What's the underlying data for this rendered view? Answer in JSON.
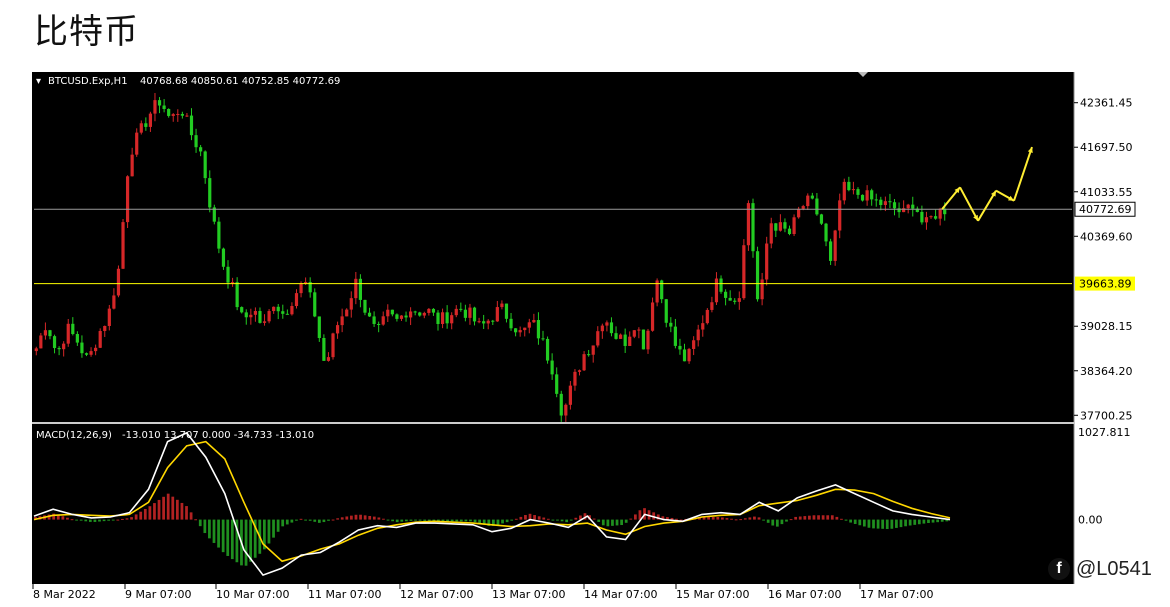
{
  "page": {
    "title": "比特币"
  },
  "watermark": {
    "text": "@L0541",
    "icon": "facebook-icon"
  },
  "colors": {
    "bull": "#d62728",
    "bear": "#22cc22",
    "macd_line": "#ffffff",
    "signal_line": "#ffd700",
    "level_price": "#ffff00",
    "current_line": "#9a9a9a",
    "arrow": "#ffee33"
  },
  "chart_data": [
    {
      "type": "candlestick",
      "title": "BTCUSD.Exp,H1",
      "ohlc_header": "40768.68 40850.61 40752.85 40772.69",
      "y_ticks": [
        "42361.45",
        "41697.50",
        "41033.55",
        "40369.60",
        "39028.15",
        "38364.20",
        "37700.25"
      ],
      "y_tick_values": [
        42361.45,
        41697.5,
        41033.55,
        40369.6,
        39028.15,
        38364.2,
        37700.25
      ],
      "ylim": [
        37600,
        42700
      ],
      "x_ticks": [
        "8 Mar 2022",
        "9 Mar 07:00",
        "10 Mar 07:00",
        "11 Mar 07:00",
        "12 Mar 07:00",
        "13 Mar 07:00",
        "14 Mar 07:00",
        "15 Mar 07:00",
        "16 Mar 07:00",
        "17 Mar 07:00"
      ],
      "current_price": 40772.69,
      "current_price_label": "40772.69",
      "level": 39663.89,
      "level_label": "39663.89",
      "grid": false,
      "path_close": [
        38700,
        39100,
        38600,
        39000,
        38800,
        38500,
        38900,
        39200,
        39900,
        41600,
        41900,
        42200,
        42400,
        42100,
        42300,
        41900,
        41600,
        40700,
        40000,
        39600,
        39100,
        39300,
        39000,
        39400,
        39200,
        39500,
        39700,
        39200,
        38400,
        39000,
        39300,
        39700,
        39200,
        38900,
        39200,
        39100,
        39300,
        39250,
        39250,
        39100,
        39200,
        39300,
        39200,
        39000,
        39150,
        39300,
        39100,
        38900,
        39100,
        38800,
        38400,
        37700,
        38200,
        38600,
        38800,
        39200,
        38900,
        38800,
        39100,
        38700,
        39800,
        39200,
        38700,
        38500,
        38900,
        39300,
        39700,
        39500,
        39400,
        40900,
        39200,
        40600,
        40500,
        40400,
        40800,
        40900,
        40600,
        39900,
        41100,
        41000,
        41000,
        40900,
        40850,
        40800,
        40700,
        40900,
        40500,
        40700,
        40772
      ],
      "forecast_arrows_note": "yellow projection arrows",
      "forecast_path": [
        40772,
        41100,
        40600,
        41050,
        40900,
        41700
      ]
    },
    {
      "type": "line",
      "title": "MACD(12,26,9)",
      "header_values": "-13.010 13.707 0.000 -34.733 -13.010",
      "y_ticks": [
        "1027.811",
        "0.00"
      ],
      "y_tick_values": [
        1027.811,
        0
      ],
      "ylim": [
        -720,
        1080
      ],
      "series": [
        {
          "name": "MACD",
          "values": [
            40,
            120,
            60,
            20,
            30,
            80,
            350,
            900,
            1000,
            720,
            300,
            -350,
            -640,
            -560,
            -410,
            -380,
            -260,
            -120,
            -70,
            -90,
            -40,
            -40,
            -50,
            -60,
            -140,
            -100,
            0,
            -40,
            -90,
            40,
            -200,
            -230,
            60,
            0,
            -20,
            60,
            80,
            60,
            200,
            100,
            250,
            330,
            400,
            300,
            200,
            100,
            60,
            30,
            0
          ]
        },
        {
          "name": "Signal",
          "values": [
            0,
            50,
            60,
            50,
            40,
            60,
            200,
            600,
            850,
            900,
            700,
            200,
            -280,
            -480,
            -420,
            -340,
            -280,
            -180,
            -100,
            -60,
            -30,
            -20,
            -30,
            -40,
            -60,
            -80,
            -70,
            -50,
            -60,
            -40,
            -120,
            -170,
            -80,
            -40,
            -20,
            30,
            50,
            60,
            160,
            190,
            220,
            280,
            350,
            340,
            300,
            210,
            130,
            70,
            20
          ]
        },
        {
          "name": "Histogram",
          "values": [
            30,
            70,
            0,
            -30,
            -10,
            20,
            150,
            300,
            150,
            -180,
            -400,
            -550,
            -360,
            -80,
            10,
            -40,
            20,
            60,
            30,
            -30,
            -10,
            -20,
            -20,
            -20,
            -80,
            -20,
            70,
            10,
            -30,
            80,
            -80,
            -60,
            140,
            40,
            0,
            30,
            30,
            0,
            40,
            -90,
            30,
            50,
            50,
            -40,
            -100,
            -110,
            -70,
            -40,
            -20
          ]
        }
      ]
    }
  ]
}
